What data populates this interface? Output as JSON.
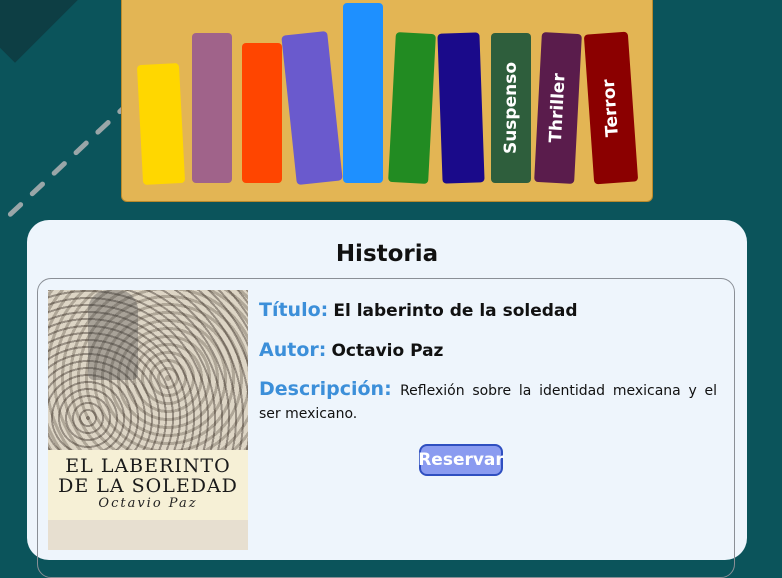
{
  "shelf": {
    "books": [
      {
        "label": "",
        "color": "#ffd700"
      },
      {
        "label": "",
        "color": "#a0638a"
      },
      {
        "label": "",
        "color": "#ff4500"
      },
      {
        "label": "",
        "color": "#6a5acd"
      },
      {
        "label": "",
        "color": "#1e90ff"
      },
      {
        "label": "",
        "color": "#228b22"
      },
      {
        "label": "",
        "color": "#1a0a8a"
      },
      {
        "label": "Suspenso",
        "color": "#2e5e3c"
      },
      {
        "label": "Thriller",
        "color": "#5a1c4c"
      },
      {
        "label": "Terror",
        "color": "#8b0000"
      }
    ]
  },
  "section": {
    "title": "Historia"
  },
  "book": {
    "cover": {
      "title_line1": "EL LABERINTO",
      "title_line2": "DE LA SOLEDAD",
      "author": "Octavio Paz"
    },
    "title_label": "Título:",
    "title_value": "El laberinto de la soledad",
    "author_label": "Autor:",
    "author_value": "Octavio Paz",
    "description_label": "Descripción:",
    "description_value": "Reflexión sobre la identidad mexicana y el ser mexicano.",
    "reserve_label": "Reservar"
  },
  "colors": {
    "background": "#0b545b",
    "shelf": "#e3b554",
    "card": "#eef5fc",
    "label_blue": "#3c8fd9",
    "button": "#8a9bf0"
  }
}
